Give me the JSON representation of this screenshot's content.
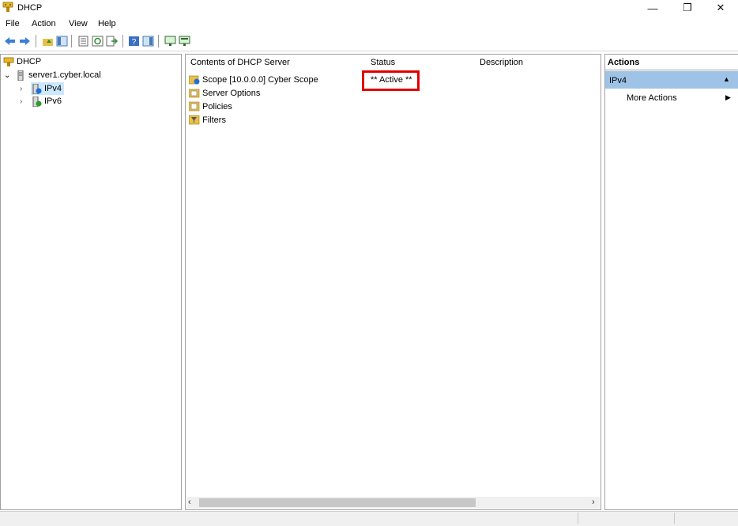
{
  "window": {
    "title": "DHCP",
    "minimize": "—",
    "restore": "❐",
    "close": "✕"
  },
  "menu": [
    "File",
    "Action",
    "View",
    "Help"
  ],
  "tree": {
    "root": "DHCP",
    "server": "server1.cyber.local",
    "ipv4": "IPv4",
    "ipv6": "IPv6"
  },
  "list": {
    "columns": [
      "Contents of DHCP Server",
      "Status",
      "Description"
    ],
    "rows": [
      {
        "name": "Scope [10.0.0.0] Cyber Scope",
        "status": "** Active **",
        "description": ""
      },
      {
        "name": "Server Options",
        "status": "",
        "description": ""
      },
      {
        "name": "Policies",
        "status": "",
        "description": ""
      },
      {
        "name": "Filters",
        "status": "",
        "description": ""
      }
    ]
  },
  "actions": {
    "header": "Actions",
    "section": "IPv4",
    "more": "More Actions"
  },
  "colors": {
    "accent": "#cce8ff",
    "actions_band": "#9ec3e6",
    "highlight_box": "#e00000"
  }
}
